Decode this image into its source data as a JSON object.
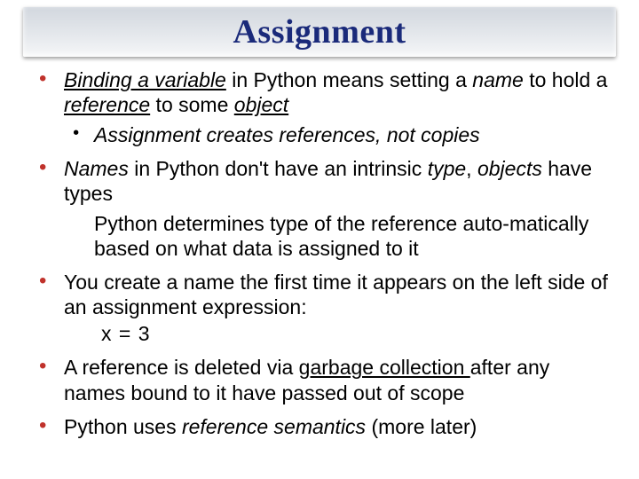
{
  "title": "Assignment",
  "b1": {
    "pre": "Binding a variable",
    "mid": " in Python means setting a ",
    "name": "name",
    "mid2": " to hold a ",
    "ref": "reference",
    "mid3": " to some ",
    "obj": "object",
    "sub": "Assignment creates references, not copies"
  },
  "b2": {
    "names": "Names",
    "mid": " in Python don't have an intrinsic ",
    "type": "type",
    "mid2": ", ",
    "objects": "objects",
    "tail": " have types",
    "sub": "Python determines type of the reference auto-matically based on what data is assigned to it"
  },
  "b3": {
    "text": "You create a name the first time it appears on the left side of an assignment expression:",
    "code": "x = 3"
  },
  "b4": {
    "pre": "A reference is deleted via ",
    "gc": "garbage collection ",
    "post": "after any names bound to it have passed out of scope"
  },
  "b5": {
    "pre": "Python uses ",
    "rs": "reference semantics",
    "post": " (more later)"
  }
}
